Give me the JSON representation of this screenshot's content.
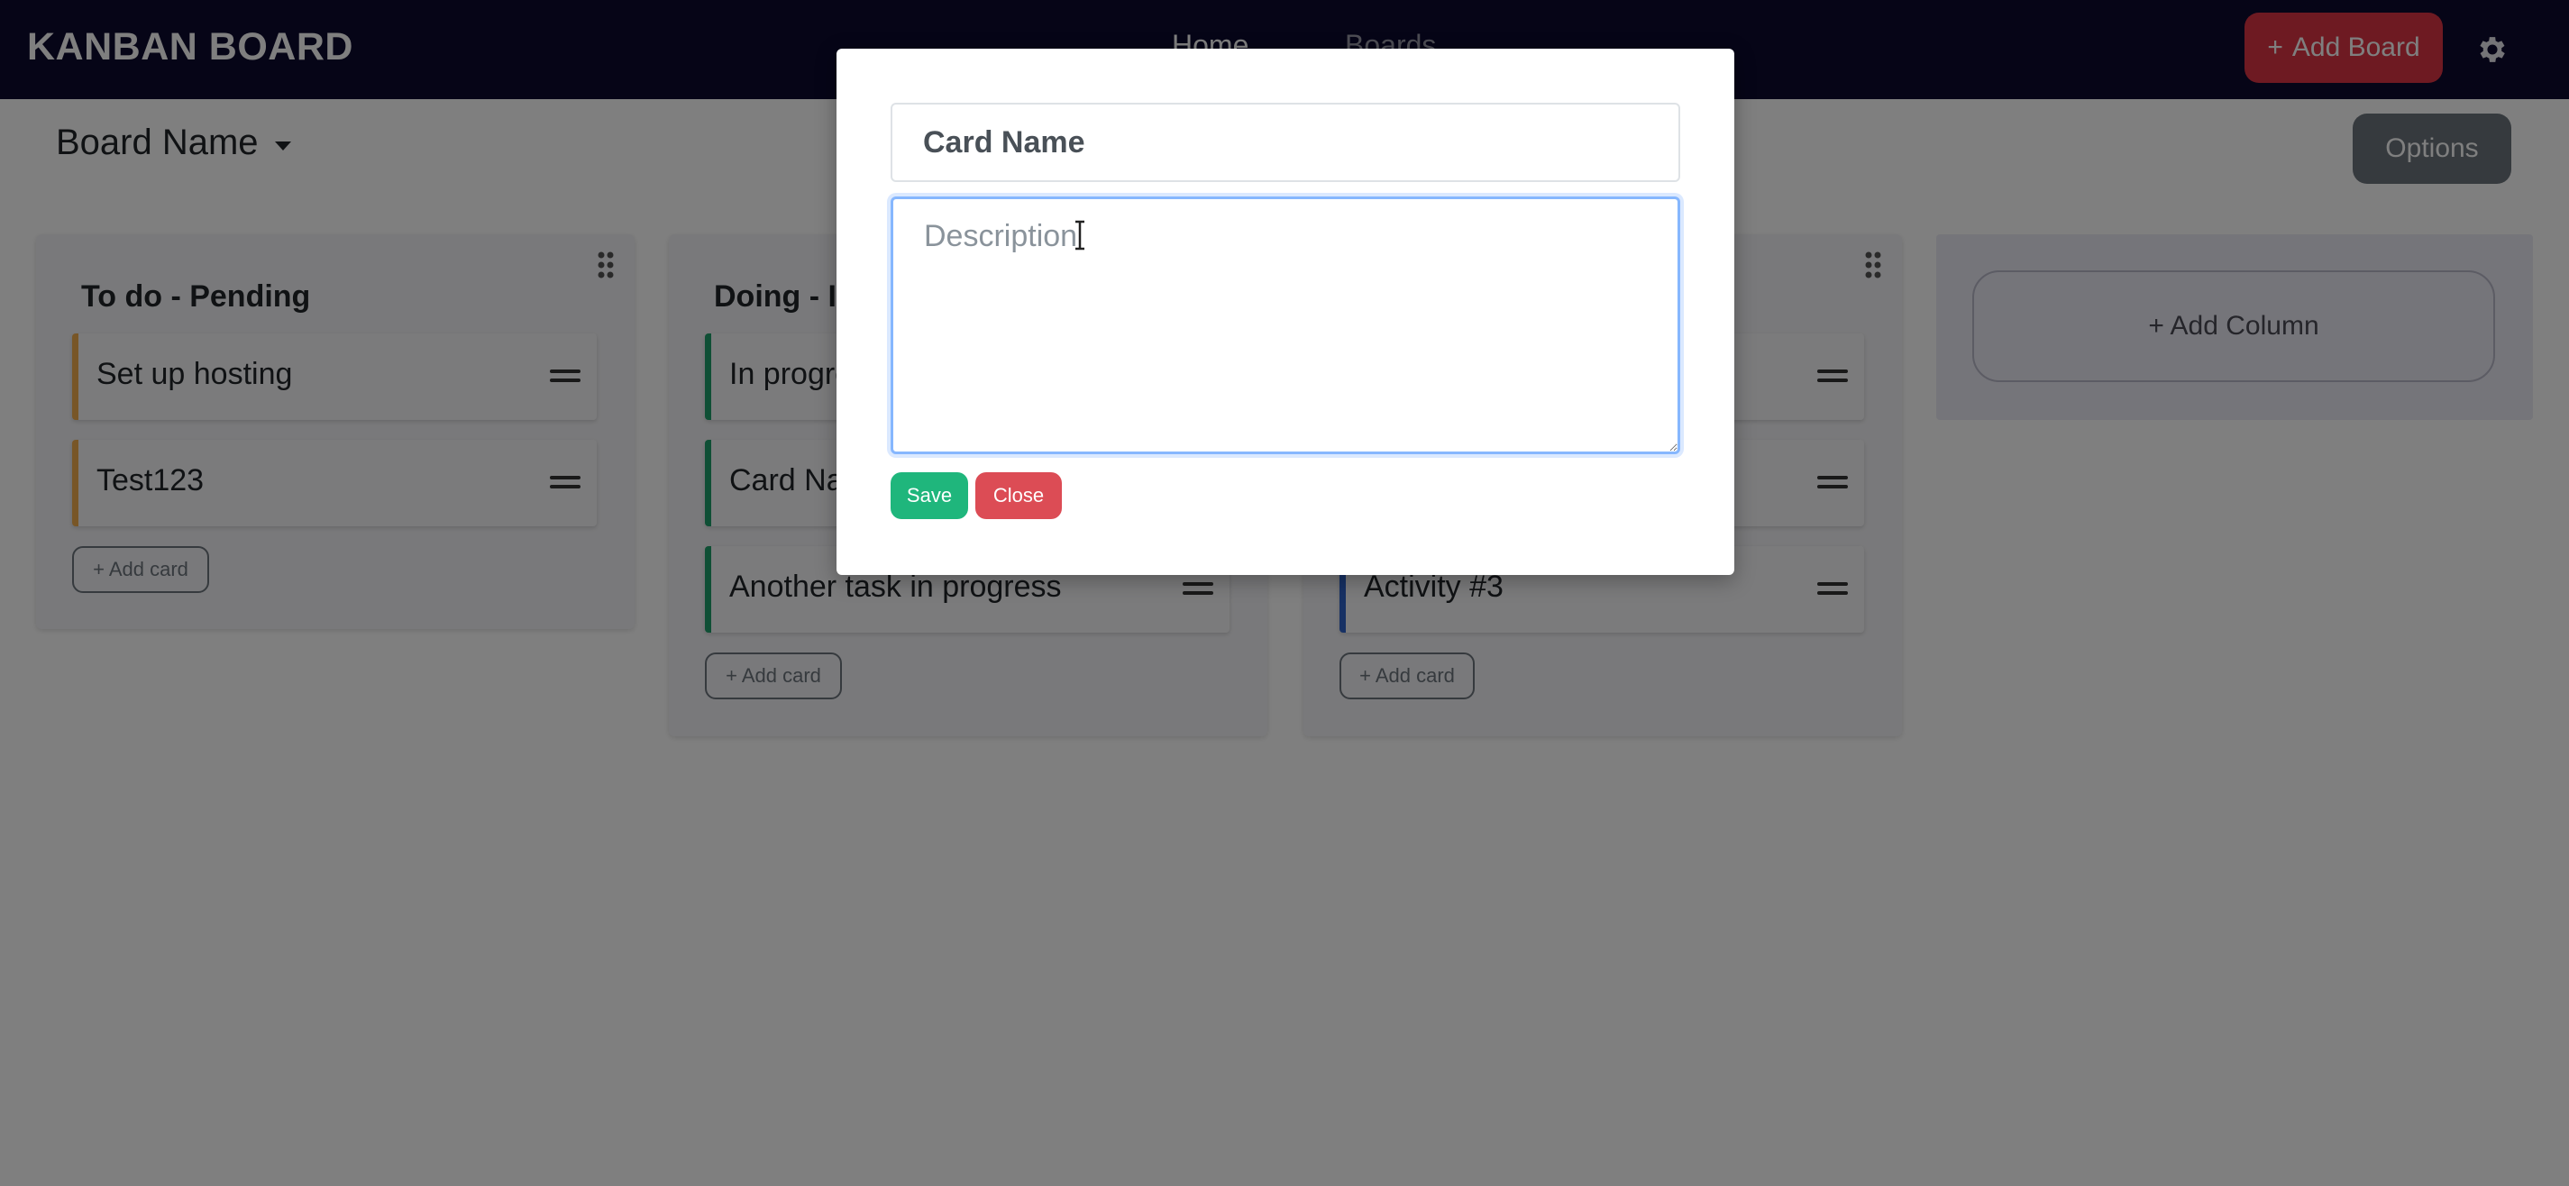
{
  "navbar": {
    "brand": "KANBAN BOARD",
    "links": [
      "Home",
      "Boards"
    ],
    "add_board": "Add Board",
    "add_board_icon": "+",
    "settings_icon": "gear-icon"
  },
  "board": {
    "name": "Board Name",
    "options": "Options"
  },
  "columns": [
    {
      "title": "To do - Pending",
      "cards": [
        "Set up hosting",
        "Test123"
      ],
      "add_card": "+ Add card"
    },
    {
      "title": "Doing - I",
      "cards": [
        "In progre",
        "Card Na",
        "Another task in progress"
      ],
      "add_card": "+ Add card"
    },
    {
      "title": "",
      "cards": [
        "",
        "",
        "Activity #3"
      ],
      "add_card": "+ Add card"
    }
  ],
  "add_column": "+ Add Column",
  "modal": {
    "card_name_value": "Card Name",
    "description_placeholder": "Description",
    "save": "Save",
    "close": "Close"
  },
  "colors": {
    "navbar": "#0d0a2e",
    "danger": "#dc3545",
    "success": "#1fb67c",
    "secondary": "#6c757d",
    "card_pending": "#f0ad4e",
    "card_doing": "#1e9e6a",
    "card_done": "#2f63c9"
  }
}
